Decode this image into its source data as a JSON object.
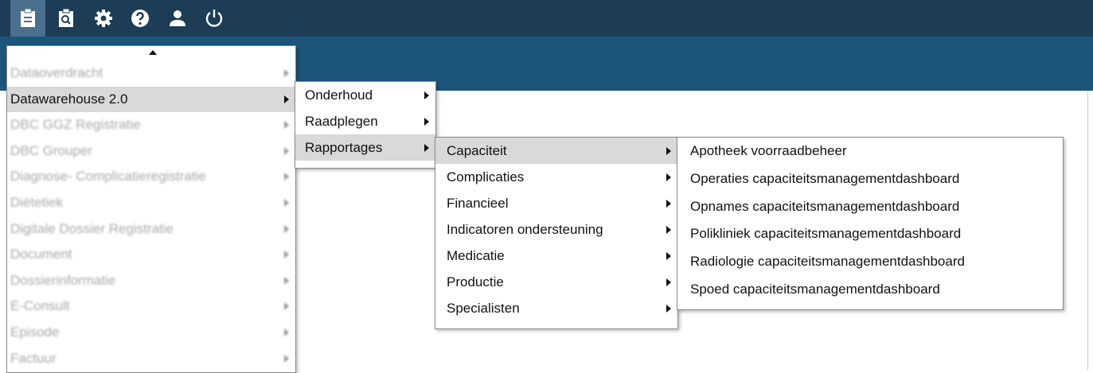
{
  "toolbar": {
    "icons": [
      "clipboard-icon",
      "report-search-icon",
      "gear-icon",
      "help-icon",
      "user-icon",
      "power-icon"
    ],
    "colors": {
      "bar": "#1d3d57",
      "active": "#4b6f8e",
      "banner": "#1c5579"
    }
  },
  "menu_level1": {
    "items": [
      {
        "label": "Dataoverdracht"
      },
      {
        "label": "Datawarehouse 2.0"
      },
      {
        "label": "DBC GGZ Registratie"
      },
      {
        "label": "DBC Grouper"
      },
      {
        "label": "Diagnose- Complicatieregistratie"
      },
      {
        "label": "Diëtetiek"
      },
      {
        "label": "Digitale Dossier Registratie"
      },
      {
        "label": "Document"
      },
      {
        "label": "Dossierinformatie"
      },
      {
        "label": "E-Consult"
      },
      {
        "label": "Episode"
      },
      {
        "label": "Factuur"
      }
    ]
  },
  "menu_level2": {
    "items": [
      {
        "label": "Onderhoud"
      },
      {
        "label": "Raadplegen"
      },
      {
        "label": "Rapportages"
      }
    ]
  },
  "menu_level3": {
    "items": [
      {
        "label": "Capaciteit"
      },
      {
        "label": "Complicaties"
      },
      {
        "label": "Financieel"
      },
      {
        "label": "Indicatoren ondersteuning"
      },
      {
        "label": "Medicatie"
      },
      {
        "label": "Productie"
      },
      {
        "label": "Specialisten"
      }
    ]
  },
  "menu_level4": {
    "items": [
      {
        "label": "Apotheek voorraadbeheer"
      },
      {
        "label": "Operaties capaciteitsmanagementdashboard"
      },
      {
        "label": "Opnames capaciteitsmanagementdashboard"
      },
      {
        "label": "Polikliniek capaciteitsmanagementdashboard"
      },
      {
        "label": "Radiologie capaciteitsmanagementdashboard"
      },
      {
        "label": "Spoed capaciteitsmanagementdashboard"
      }
    ]
  }
}
